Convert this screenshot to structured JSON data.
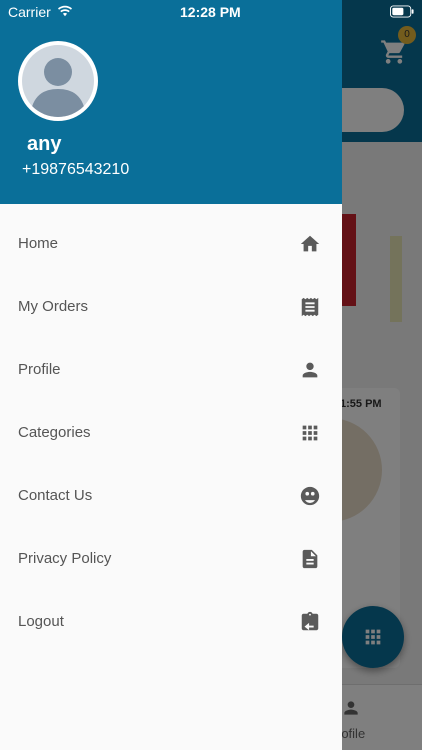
{
  "status_bar": {
    "carrier": "Carrier",
    "time": "12:28 PM"
  },
  "drawer": {
    "user": {
      "name": "any",
      "phone": "+19876543210"
    },
    "items": [
      {
        "label": "Home",
        "icon": "home-icon"
      },
      {
        "label": "My Orders",
        "icon": "receipt-icon"
      },
      {
        "label": "Profile",
        "icon": "person-icon"
      },
      {
        "label": "Categories",
        "icon": "grid-icon"
      },
      {
        "label": "Contact Us",
        "icon": "support-icon"
      },
      {
        "label": "Privacy Policy",
        "icon": "document-icon"
      },
      {
        "label": "Logout",
        "icon": "logout-icon"
      }
    ]
  },
  "background": {
    "cart_count": "0",
    "card_time": "1:55 PM",
    "bottom_nav_label": "rofile"
  },
  "colors": {
    "primary": "#0a6f99",
    "badge": "#e7b93a",
    "menu_text": "#555555",
    "icon": "#5a5a5a"
  }
}
